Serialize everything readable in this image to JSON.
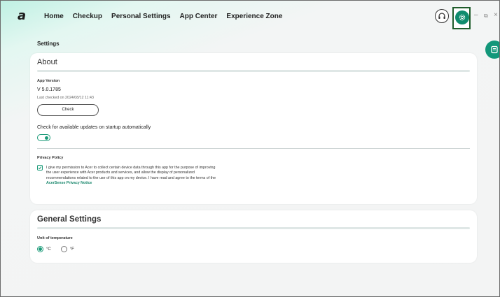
{
  "app": {
    "logo_glyph": "a",
    "accent_color": "#1a9a78",
    "gear_bg_color": "#0f8c6d"
  },
  "nav": {
    "items": [
      {
        "label": "Home"
      },
      {
        "label": "Checkup"
      },
      {
        "label": "Personal Settings"
      },
      {
        "label": "App Center"
      },
      {
        "label": "Experience Zone"
      }
    ]
  },
  "window": {
    "minimize_glyph": "–",
    "restore_glyph": "⧉",
    "close_glyph": "×",
    "headset_icon": "headset-icon",
    "settings_icon": "gear-icon"
  },
  "page": {
    "title": "Settings"
  },
  "about": {
    "title": "About",
    "app_version_label": "App Version",
    "version": "V 5.0.1785",
    "last_checked": "Last checked on 2024/08/12 11:43",
    "check_button": "Check",
    "auto_update_label": "Check for available updates on startup automatically",
    "auto_update_enabled": true,
    "privacy_label": "Privacy Policy",
    "privacy_checked": true,
    "privacy_text": "I give my permission to Acer to collect certain device data through this app for the purpose of improving the user experience with Acer products and services, and allow the display of personalized recommendations related to the use of this app on my device. I have read and agree to the terms of the",
    "privacy_link": "AcerSense Privacy Notice"
  },
  "general": {
    "title": "General Settings",
    "temp_label": "Unit of temperature",
    "options": [
      {
        "label": "°C",
        "selected": true
      },
      {
        "label": "°F",
        "selected": false
      }
    ]
  }
}
